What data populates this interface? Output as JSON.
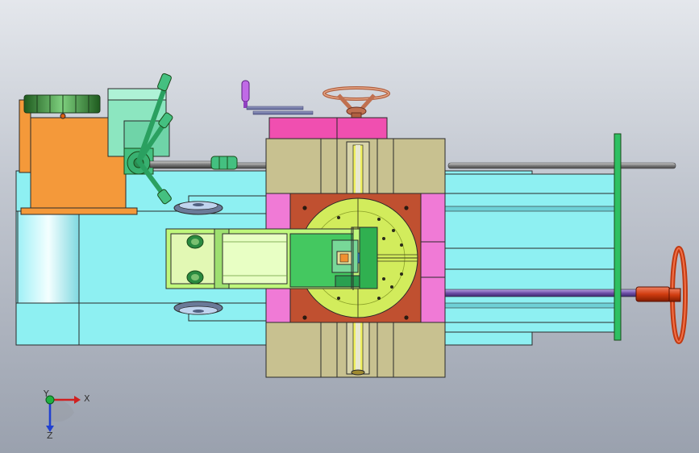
{
  "viewport": {
    "background": "#b4bac4"
  },
  "colors": {
    "bed": "#8ef0f2",
    "motor": "#f4993a",
    "carriage": "#c8c190",
    "pink": "#f07ad6",
    "plate": "#c05030",
    "disk": "#d2ec5c",
    "lightgreen": "#bff77c",
    "green": "#30c060",
    "rod": "#8b8b8b",
    "red": "#e04818",
    "violet": "#a050d0",
    "mint": "#8ce6c0"
  },
  "triad": {
    "x_label": "X",
    "y_label": "Y",
    "z_label": "Z"
  }
}
